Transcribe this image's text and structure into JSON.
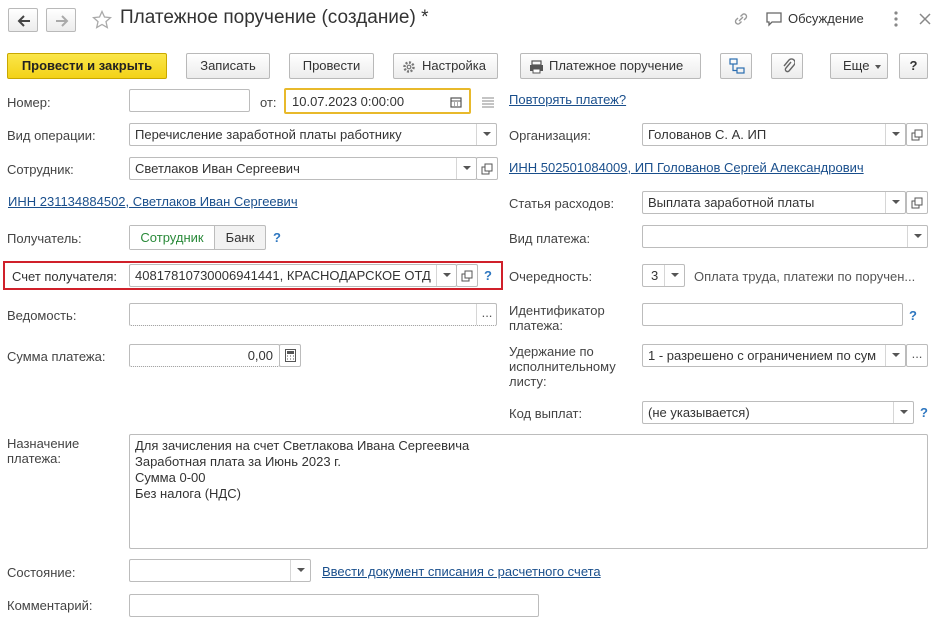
{
  "window": {
    "title": "Платежное поручение (создание) *",
    "discussion": "Обсуждение"
  },
  "toolbar": {
    "post_close": "Провести и закрыть",
    "save": "Записать",
    "post": "Провести",
    "settings": "Настройка",
    "print": "Платежное поручение",
    "more": "Еще",
    "help": "?"
  },
  "form": {
    "number_label": "Номер:",
    "number_value": "",
    "date_prefix": "от:",
    "date_value": "10.07.2023  0:00:00",
    "repeat_link": "Повторять платеж?",
    "operation_label": "Вид операции:",
    "operation_value": "Перечисление заработной платы работнику",
    "org_label": "Организация:",
    "org_value": "Голованов С. А. ИП",
    "employee_label": "Сотрудник:",
    "employee_value": "Светлаков Иван Сергеевич",
    "org_inn_link": "ИНН 502501084009, ИП Голованов Сергей Александрович",
    "employee_inn_link": "ИНН 231134884502, Светлаков Иван Сергеевич",
    "expense_label": "Статья расходов:",
    "expense_value": "Выплата заработной платы",
    "recipient_label": "Получатель:",
    "recipient_opt1": "Сотрудник",
    "recipient_opt2": "Банк",
    "recipient_help": "?",
    "paytype_label": "Вид платежа:",
    "paytype_value": "",
    "account_label": "Счет получателя:",
    "account_value": "40817810730006941441, КРАСНОДАРСКОЕ ОТД",
    "account_help": "?",
    "priority_label": "Очередность:",
    "priority_value": "3",
    "priority_desc": "Оплата труда, платежи по поручен...",
    "statement_label": "Ведомость:",
    "statement_value": "",
    "payid_label": "Идентификатор платежа:",
    "payid_value": "",
    "payid_help": "?",
    "amount_label": "Сумма платежа:",
    "amount_value": "0,00",
    "withhold_label": "Удержание по исполнительному листу:",
    "withhold_value": "1 - разрешено с ограничением по сум",
    "paycode_label": "Код выплат:",
    "paycode_value": "(не указывается)",
    "paycode_help": "?",
    "purpose_label": "Назначение платежа:",
    "purpose_lines": [
      "Для зачисления на счет Светлакова Ивана Сергеевича",
      "Заработная плата за Июнь 2023 г.",
      "Сумма 0-00",
      "Без налога (НДС)"
    ],
    "state_label": "Состояние:",
    "state_value": "",
    "writeoff_link": "Ввести документ списания с расчетного счета",
    "comment_label": "Комментарий:",
    "comment_value": ""
  },
  "colors": {
    "primary_button": "#f5d81e",
    "link": "#1a4f8c",
    "highlight_border": "#d0202a",
    "date_border": "#e8b92b",
    "help": "#2e77c0",
    "radio_selected_text": "#2a8a3a"
  }
}
